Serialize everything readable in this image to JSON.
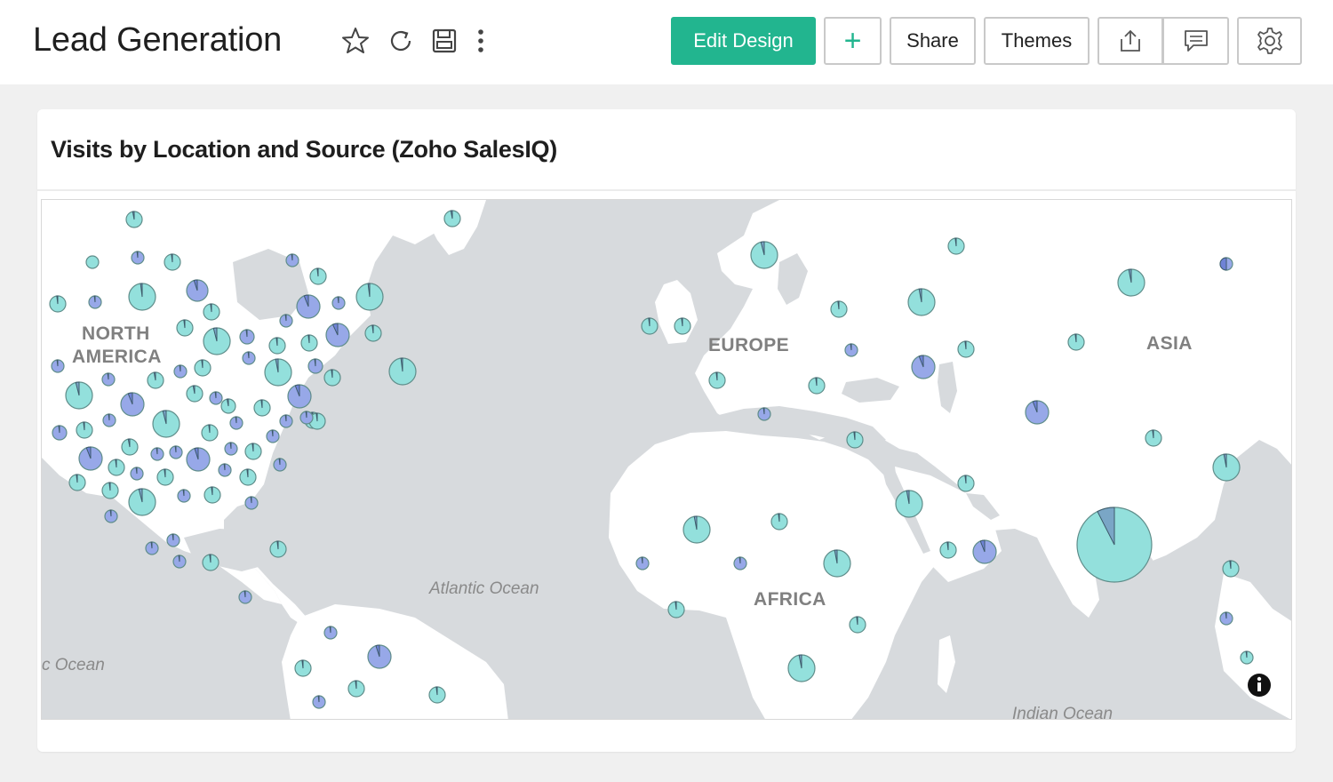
{
  "header": {
    "title": "Lead Generation",
    "buttons": {
      "edit_design": "Edit Design",
      "add": "+",
      "share": "Share",
      "themes": "Themes"
    }
  },
  "card": {
    "title": "Visits by Location and Source (Zoho SalesIQ)"
  },
  "map": {
    "region_labels": [
      {
        "text": "NORTH"
      },
      {
        "text": "AMERICA"
      },
      {
        "text": "EUROPE"
      },
      {
        "text": "ASIA"
      },
      {
        "text": "AFRICA"
      }
    ],
    "ocean_labels": [
      {
        "text": "Atlantic Ocean"
      },
      {
        "text": "c Ocean"
      },
      {
        "text": "Indian Ocean"
      }
    ]
  },
  "colors": {
    "accent": "#22b58f",
    "ocean": "#d7dadd",
    "land": "#ffffff",
    "pie_teal": "#93e0dc",
    "pie_blue": "#97a8e8"
  }
}
